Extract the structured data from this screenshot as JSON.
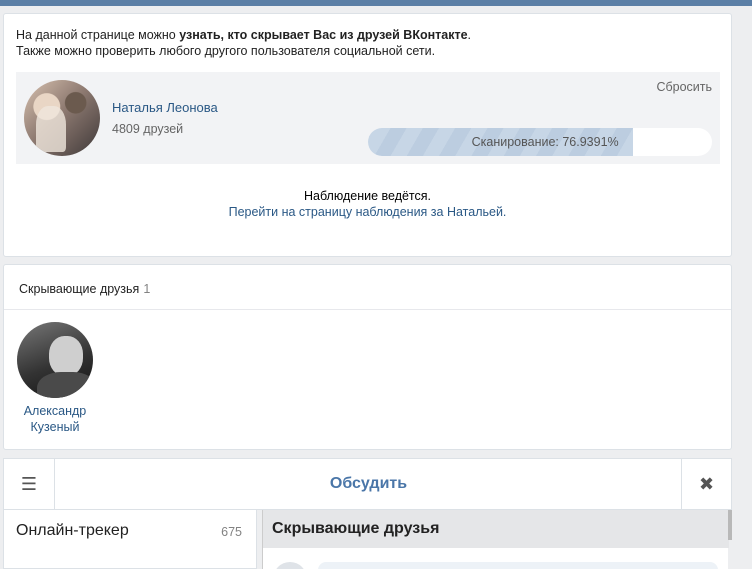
{
  "intro": {
    "line1_prefix": "На данной странице можно ",
    "line1_bold": "узнать, кто скрывает Вас из друзей ВКонтакте",
    "line1_suffix": ".",
    "line2": "Также можно проверить любого другого пользователя социальной сети."
  },
  "profile": {
    "name": "Наталья Леонова",
    "friends": "4809 друзей",
    "reset_label": "Сбросить",
    "progress_label": "Сканирование: 76.9391%",
    "progress_percent": 76.9391
  },
  "watch": {
    "status": "Наблюдение ведётся.",
    "link": "Перейти на страницу наблюдения за Натальей."
  },
  "hidden_friends": {
    "title": "Скрывающие друзья",
    "count": "1",
    "items": [
      {
        "first_name": "Александр",
        "last_name": "Кузеный"
      }
    ]
  },
  "discuss": {
    "menu_icon": "☰",
    "title": "Обсудить",
    "close_icon": "✖"
  },
  "tracker": {
    "label": "Онлайн-трекер",
    "count": "675"
  },
  "right_panel": {
    "title": "Скрывающие друзья"
  },
  "colors": {
    "link": "#2a5885",
    "accent": "#4a76a8",
    "topbar": "#5b7fa6"
  }
}
